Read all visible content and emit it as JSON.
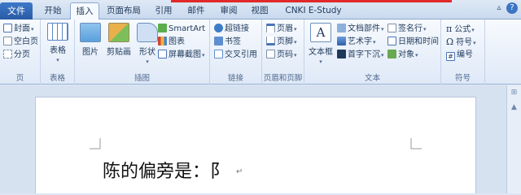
{
  "tabs": {
    "file": "文件",
    "items": [
      "开始",
      "插入",
      "页面布局",
      "引用",
      "邮件",
      "审阅",
      "视图",
      "CNKI E-Study"
    ],
    "active": "插入"
  },
  "ribbon": {
    "page_group": {
      "label": "页",
      "items": [
        "封面",
        "空白页",
        "分页"
      ]
    },
    "table_group": {
      "label": "表格",
      "table": "表格"
    },
    "illustrations_group": {
      "label": "插图",
      "picture": "图片",
      "clipart": "剪贴画",
      "shapes": "形状",
      "smartart": "SmartArt",
      "chart": "图表",
      "screenshot": "屏幕截图"
    },
    "links_group": {
      "label": "链接",
      "items": [
        "超链接",
        "书签",
        "交叉引用"
      ]
    },
    "header_footer_group": {
      "label": "页眉和页脚",
      "items": [
        "页眉",
        "页脚",
        "页码"
      ]
    },
    "text_group": {
      "label": "文本",
      "textbox": "文本框",
      "items_col1": [
        "文档部件",
        "艺术字",
        "首字下沉"
      ],
      "items_col2": [
        "签名行",
        "日期和时间",
        "对象"
      ]
    },
    "symbols_group": {
      "label": "符号",
      "items": [
        "公式",
        "符号",
        "编号"
      ]
    }
  },
  "document": {
    "text": "陈的偏旁是：阝",
    "para_mark": "↵"
  },
  "colors": {
    "file_tab": "#2a5ba6",
    "ribbon_bg": "#e6eef9",
    "page": "#ffffff",
    "accent_red": "#e02a2a"
  }
}
